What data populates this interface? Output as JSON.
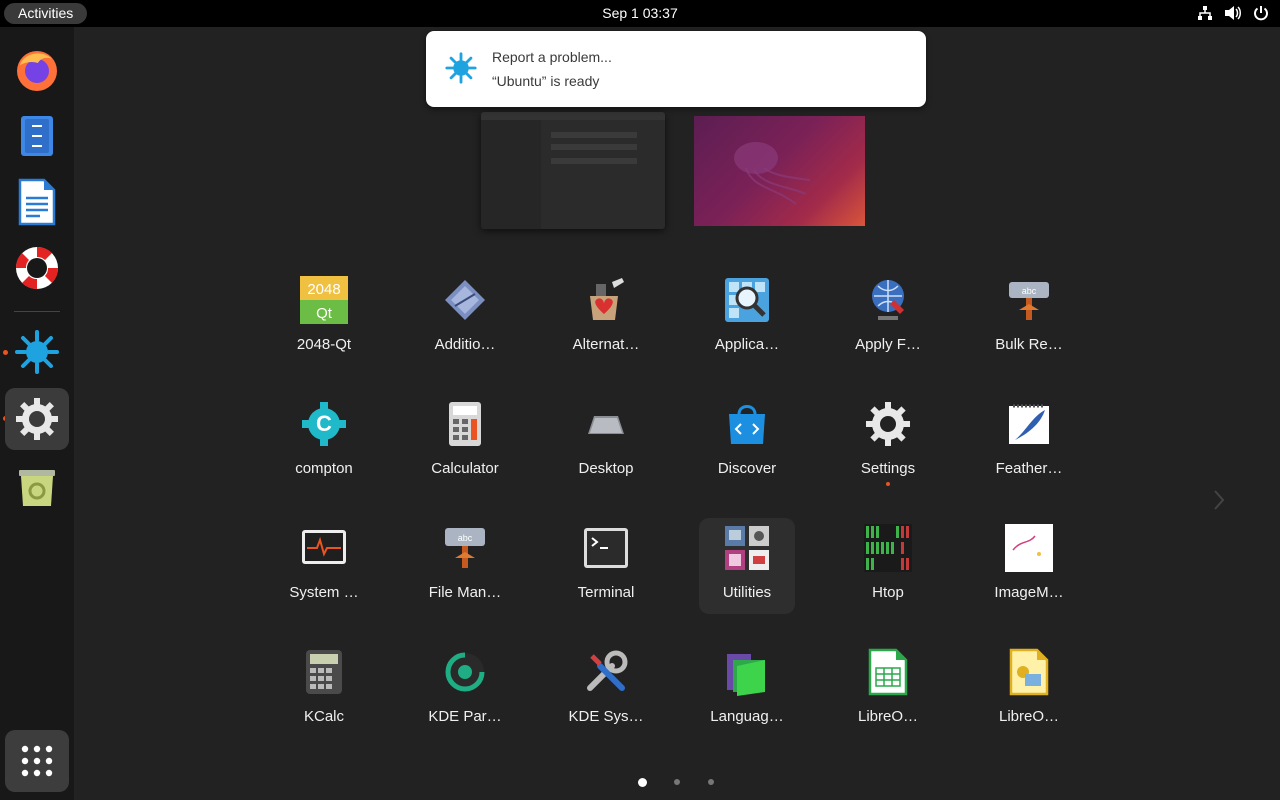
{
  "topbar": {
    "activities": "Activities",
    "clock": "Sep 1  03:37",
    "tray_icons": [
      "network-icon",
      "volume-icon",
      "power-icon"
    ]
  },
  "dock": {
    "items": [
      {
        "name": "firefox",
        "icon": "firefox-icon"
      },
      {
        "name": "files",
        "icon": "files-icon"
      },
      {
        "name": "writer",
        "icon": "libreoffice-writer-icon"
      },
      {
        "name": "help",
        "icon": "lifebuoy-icon"
      },
      {
        "name": "report",
        "icon": "splash-icon",
        "running": true
      },
      {
        "name": "settings",
        "icon": "gear-icon",
        "running": true,
        "active": true
      },
      {
        "name": "trash",
        "icon": "trash-icon"
      }
    ],
    "show_apps_icon": "grid-icon"
  },
  "notification": {
    "title": "Report a problem...",
    "body": "“Ubuntu” is ready",
    "icon": "splash-icon"
  },
  "apps": [
    {
      "label": "2048-Qt",
      "icon": "2048-icon"
    },
    {
      "label": "Additio…",
      "icon": "additional-drivers-icon"
    },
    {
      "label": "Alternat…",
      "icon": "alternatives-icon"
    },
    {
      "label": "Applica…",
      "icon": "app-finder-icon"
    },
    {
      "label": "Apply F…",
      "icon": "apply-filter-icon"
    },
    {
      "label": "Bulk Re…",
      "icon": "bulk-rename-icon"
    },
    {
      "label": "compton",
      "icon": "compton-icon"
    },
    {
      "label": "Calculator",
      "icon": "calculator-icon"
    },
    {
      "label": "Desktop",
      "icon": "desktop-icon"
    },
    {
      "label": "Discover",
      "icon": "discover-icon"
    },
    {
      "label": "Settings",
      "icon": "settings-icon",
      "running": true
    },
    {
      "label": "Feather…",
      "icon": "feather-icon"
    },
    {
      "label": "System …",
      "icon": "system-monitor-icon"
    },
    {
      "label": "File Man…",
      "icon": "file-manager-icon"
    },
    {
      "label": "Terminal",
      "icon": "terminal-icon"
    },
    {
      "label": "Utilities",
      "icon": "utilities-folder-icon",
      "highlighted": true
    },
    {
      "label": "Htop",
      "icon": "htop-icon"
    },
    {
      "label": "ImageM…",
      "icon": "imagemagick-icon"
    },
    {
      "label": "KCalc",
      "icon": "kcalc-icon"
    },
    {
      "label": "KDE Par…",
      "icon": "kde-partition-icon"
    },
    {
      "label": "KDE Sys…",
      "icon": "kde-system-icon"
    },
    {
      "label": "Languag…",
      "icon": "language-icon"
    },
    {
      "label": "LibreO…",
      "icon": "libreoffice-calc-icon"
    },
    {
      "label": "LibreO…",
      "icon": "libreoffice-draw-icon"
    }
  ],
  "pager": {
    "pages": 3,
    "current": 1
  }
}
